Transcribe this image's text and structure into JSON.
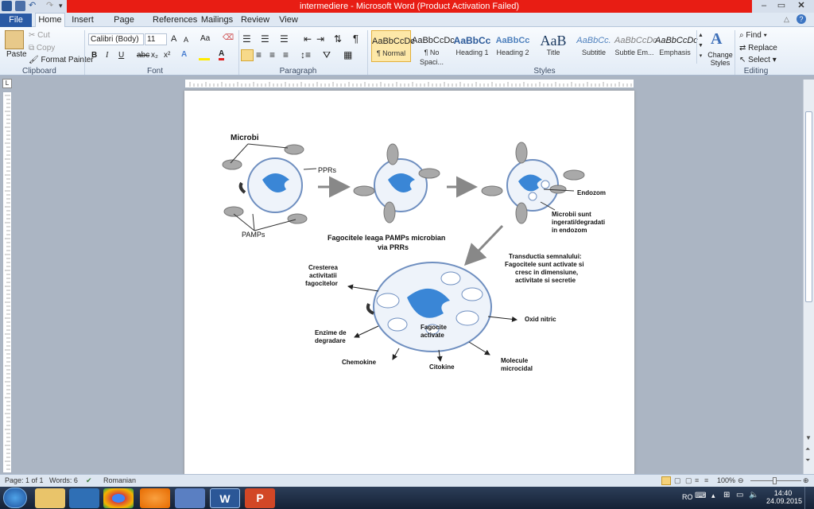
{
  "window": {
    "title": "intermediere - Microsoft Word (Product Activation Failed)"
  },
  "tabs": [
    "File",
    "Home",
    "Insert",
    "Page Layout",
    "References",
    "Mailings",
    "Review",
    "View"
  ],
  "clipboard": {
    "paste": "Paste",
    "cut": "Cut",
    "copy": "Copy",
    "format_painter": "Format Painter",
    "label": "Clipboard"
  },
  "font": {
    "name": "Calibri (Body)",
    "size": "11",
    "label": "Font",
    "grow": "A",
    "shrink": "A",
    "case": "Aa",
    "bold": "B",
    "italic": "I",
    "underline": "U",
    "strike": "abc",
    "sub": "x₂",
    "sup": "x²"
  },
  "paragraph": {
    "label": "Paragraph"
  },
  "styles": {
    "label": "Styles",
    "items": [
      {
        "sample": "AaBbCcDc",
        "name": "¶ Normal"
      },
      {
        "sample": "AaBbCcDc",
        "name": "¶ No Spaci..."
      },
      {
        "sample": "AaBbCc",
        "name": "Heading 1"
      },
      {
        "sample": "AaBbCc",
        "name": "Heading 2"
      },
      {
        "sample": "AaB",
        "name": "Title"
      },
      {
        "sample": "AaBbCc.",
        "name": "Subtitle"
      },
      {
        "sample": "AaBbCcDc",
        "name": "Subtle Em..."
      },
      {
        "sample": "AaBbCcDc",
        "name": "Emphasis"
      }
    ],
    "change_styles": "Change Styles"
  },
  "editing": {
    "label": "Editing",
    "find": "Find",
    "replace": "Replace",
    "select": "Select"
  },
  "diagram": {
    "microbi": "Microbi",
    "pprs": "PPRs",
    "pamps": "PAMPs",
    "endozom": "Endozom",
    "microbii1": "Microbii sunt",
    "microbii2": "ingerati/degradati",
    "microbii3": "in endozom",
    "fago1": "Fagocitele leaga PAMPs microbian",
    "fago2": "via PRRs",
    "trans1": "Transductia  semnalului:",
    "trans2": "Fagocitele sunt activate si",
    "trans3": "cresc in dimensiune,",
    "trans4": "activitate si secretie",
    "crest1": "Cresterea",
    "crest2": "activitatii",
    "crest3": "fagocitelor",
    "enz1": "Enzime de",
    "enz2": "degradare",
    "chemokine": "Chemokine",
    "citokine": "Citokine",
    "mol1": "Molecule",
    "mol2": "microcidal",
    "oxid": "Oxid nitric",
    "fagact1": "Fagocite",
    "fagact2": "activate"
  },
  "status": {
    "page": "Page: 1 of 1",
    "words": "Words: 6",
    "language": "Romanian",
    "zoom": "100%"
  },
  "tray": {
    "lang": "RO",
    "time": "14:40",
    "date": "24.09.2015"
  },
  "colors": {
    "title_bar": "#e81d14",
    "file_tab": "#2a5aa5",
    "nucleus": "#3a86d6"
  }
}
